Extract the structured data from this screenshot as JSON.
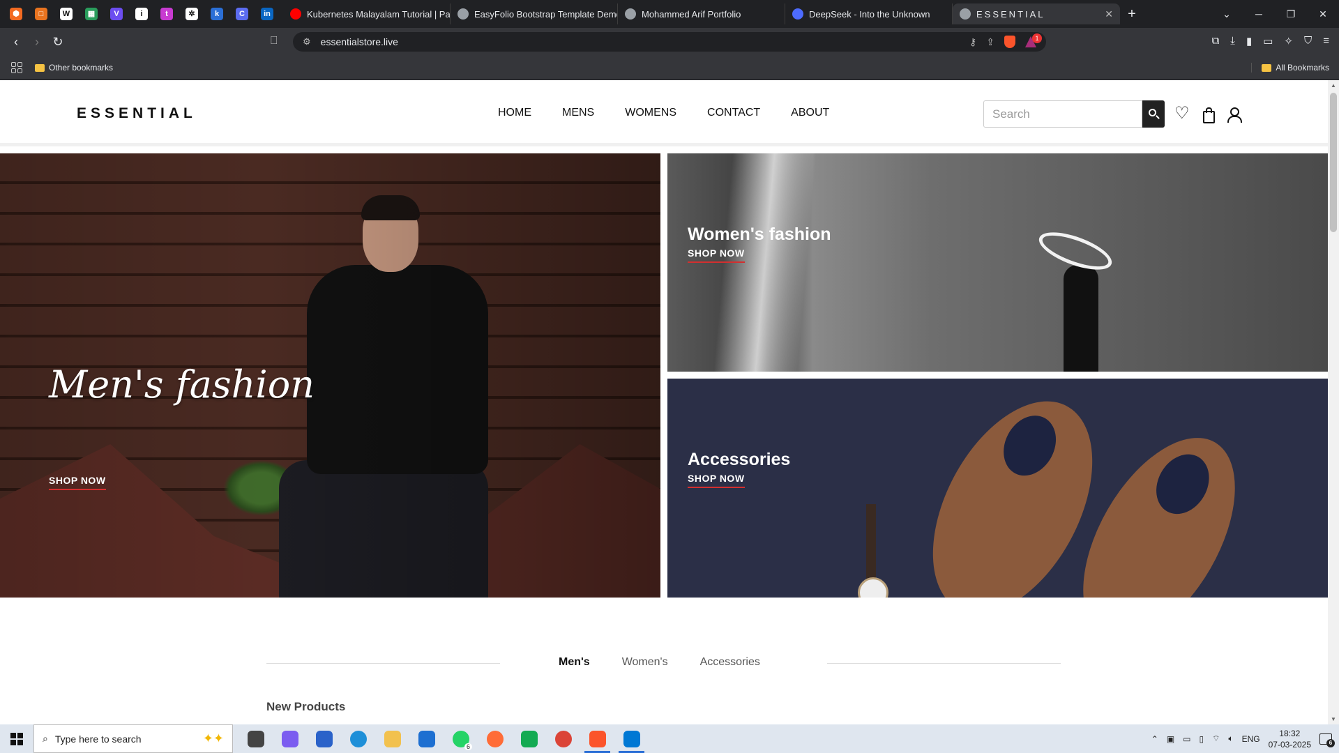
{
  "browser": {
    "tabs": [
      {
        "title": "Kubernetes Malayalam Tutorial | Pa",
        "favicon_color": "#ff0000"
      },
      {
        "title": "EasyFolio Bootstrap Template Demo",
        "favicon_color": "#9aa0a6"
      },
      {
        "title": "Mohammed Arif Portfolio",
        "favicon_color": "#9aa0a6"
      },
      {
        "title": "DeepSeek - Into the Unknown",
        "favicon_color": "#4d6bfe"
      },
      {
        "title": "ESSENTIAL",
        "favicon_color": "#9aa0a6",
        "active": true
      }
    ],
    "pinned_icons": [
      "brave-icon",
      "square-icon",
      "word-icon",
      "sheet-icon",
      "v-icon",
      "info-icon",
      "t-icon",
      "spark-icon",
      "k-icon",
      "c-icon",
      "linkedin-icon"
    ],
    "pinned_letters": [
      "⬢",
      "□",
      "W",
      "▦",
      "V",
      "i",
      "t",
      "✲",
      "k",
      "C",
      "in"
    ],
    "url": "essentialstore.live",
    "notification_badge": "1",
    "bookmarks": {
      "other": "Other bookmarks",
      "all": "All Bookmarks"
    }
  },
  "site": {
    "logo": "ESSENTIAL",
    "nav": [
      "HOME",
      "MENS",
      "WOMENS",
      "CONTACT",
      "ABOUT"
    ],
    "search_placeholder": "Search",
    "hero": {
      "men": {
        "title": "Men's fashion",
        "cta": "SHOP NOW"
      },
      "women": {
        "title": "Women's fashion",
        "cta": "SHOP NOW"
      },
      "accessories": {
        "title": "Accessories",
        "cta": "SHOP NOW"
      }
    },
    "category_tabs": [
      "Men's",
      "Women's",
      "Accessories"
    ],
    "active_category": "Men's",
    "section_heading": "New Products",
    "accent_color": "#d32f2f"
  },
  "taskbar": {
    "search_placeholder": "Type here to search",
    "apps": [
      {
        "name": "task-view-icon",
        "color": "#444444"
      },
      {
        "name": "copilot-icon",
        "color": "#7b5cf0"
      },
      {
        "name": "store-icon",
        "color": "#2a62c9"
      },
      {
        "name": "edge-icon",
        "color": "#1e8fd8"
      },
      {
        "name": "file-explorer-icon",
        "color": "#f2c14e"
      },
      {
        "name": "mail-icon",
        "color": "#1d6fd1"
      },
      {
        "name": "whatsapp-icon",
        "color": "#25d366",
        "badge": "6"
      },
      {
        "name": "postman-icon",
        "color": "#ff6c37"
      },
      {
        "name": "mongodb-icon",
        "color": "#13aa52"
      },
      {
        "name": "chrome-icon",
        "color": "#db4437"
      },
      {
        "name": "brave-taskbar-icon",
        "color": "#fb542b",
        "active": true
      },
      {
        "name": "vscode-icon",
        "color": "#0078d4",
        "active": true
      }
    ],
    "language": "ENG",
    "time": "18:32",
    "date": "07-03-2025",
    "notification_count": "6"
  }
}
